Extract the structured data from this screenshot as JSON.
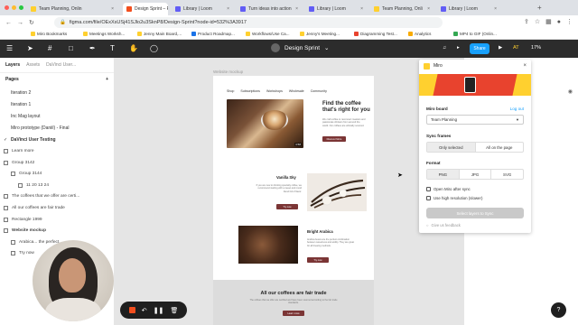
{
  "browser": {
    "window_buttons": [
      "#ff5f57",
      "#febc2e",
      "#28c840"
    ],
    "tabs": [
      {
        "title": "Team Planning, Onlin",
        "fav": "#ffd02f",
        "active": false
      },
      {
        "title": "Design Sprint – F",
        "fav": "#f24e1e",
        "active": true
      },
      {
        "title": "Library | Loom",
        "fav": "#625df5",
        "active": false
      },
      {
        "title": "Turn ideas into action",
        "fav": "#625df5",
        "active": false
      },
      {
        "title": "Library | Loom",
        "fav": "#625df5",
        "active": false
      },
      {
        "title": "Team Planning, Onli",
        "fav": "#ffd02f",
        "active": false
      },
      {
        "title": "Library | Loom",
        "fav": "#625df5",
        "active": false
      }
    ],
    "new_tab": "+",
    "url": "figma.com/file/OExXsUSj41SJlo2u3SknP8/Design-Sprint?node-id=532%3A3917",
    "bookmarks": [
      {
        "label": "Miro Bookmarks",
        "color": "#ffd02f"
      },
      {
        "label": "Meetings Worksh...",
        "color": "#ffd02f"
      },
      {
        "label": "Jenny Main Board,...",
        "color": "#ffd02f"
      },
      {
        "label": "Product Roadmap...",
        "color": "#1a73e8"
      },
      {
        "label": "Workflows/Use Ca...",
        "color": "#ffd02f"
      },
      {
        "label": "Jenny's Meeting...",
        "color": "#ffd02f"
      },
      {
        "label": "Diagramming Test...",
        "color": "#e8432e"
      },
      {
        "label": "Analytics",
        "color": "#f9ab00"
      },
      {
        "label": "MP4 to GIF (Onlin...",
        "color": "#34a853"
      }
    ]
  },
  "figma": {
    "title": "Design Sprint",
    "share_label": "Share",
    "zoom": "17%",
    "avatar_initials": "AT",
    "left_panel": {
      "tabs": [
        "Layers",
        "Assets",
        "DaVinci User..."
      ],
      "pages_label": "Pages",
      "pages": [
        {
          "name": "Iteration 2",
          "selected": false
        },
        {
          "name": "Iteration 1",
          "selected": false
        },
        {
          "name": "Inc Mag layout",
          "selected": false
        },
        {
          "name": "Miro prototype (Daniil) - Final",
          "selected": false
        },
        {
          "name": "DaVinci User Testing",
          "selected": true
        }
      ],
      "layers": [
        {
          "name": "Learn more",
          "indent": 0
        },
        {
          "name": "Group 3142",
          "indent": 0
        },
        {
          "name": "Group 3144",
          "indent": 1
        },
        {
          "name": "11 20 13 24",
          "indent": 2
        },
        {
          "name": "The coffees that we offer are certi...",
          "indent": 0
        },
        {
          "name": "All our coffees are fair trade",
          "indent": 0
        },
        {
          "name": "Rectangle 1999",
          "indent": 0
        },
        {
          "name": "Website mockup",
          "indent": 0,
          "bold": true
        },
        {
          "name": "Arabica... the perfect...",
          "indent": 1
        },
        {
          "name": "Try now",
          "indent": 1
        }
      ]
    },
    "canvas": {
      "frame_label": "Website mockup",
      "nav": [
        "Shop",
        "Subscriptions",
        "Workshops",
        "Wholesale",
        "Community"
      ],
      "hero_title": "Find the coffee that's right for you",
      "hero_text": "We craft coffee to reconnect roasters and passionate drinkers from around the world. Our coffees are ethically sourced.",
      "hero_button": "Discover More",
      "image_badge": "4:58",
      "section1_title": "Vanilla Sky",
      "section1_text": "If you are new to drinking specialty coffee, we recommend starting with a sweet and round blend full of flavor.",
      "section1_button": "Try now",
      "section2_title": "Bright Arabica",
      "section2_text": "Arabica beans are the perfect combination between sweetness and acidity. They are great for all brewing methods.",
      "section2_button": "Try now",
      "footer_title": "All our coffees are fair trade",
      "footer_text": "The coffees that we offer are certified and have been sourced according to the fair trade standards.",
      "footer_button": "Learn more"
    },
    "miro_plugin": {
      "title": "Miro",
      "board_label": "Miro board",
      "logout_label": "Log out",
      "board_value": "Team Planning",
      "sync_frames_label": "Sync frames",
      "sync_options": [
        "Only selected",
        "All on the page"
      ],
      "sync_selected": 0,
      "format_label": "Format",
      "format_options": [
        "PNG",
        "JPG",
        "SVG"
      ],
      "format_selected": 0,
      "checkbox1": "Open Miro after sync",
      "checkbox2": "Use high resolution (slower)",
      "sync_button": "Select layers to Sync",
      "feedback": "Give us feedback"
    }
  },
  "recording": {
    "help": "?"
  }
}
